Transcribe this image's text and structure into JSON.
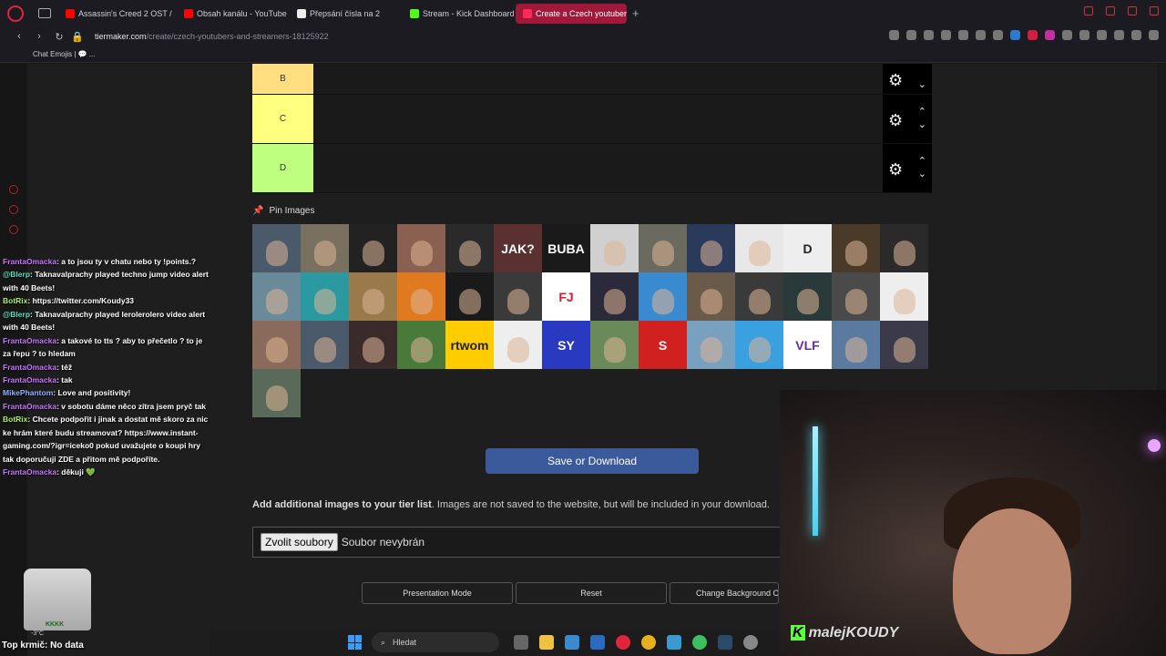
{
  "browser": {
    "tabs": [
      {
        "label": "Assassin's Creed 2 OST / ...",
        "color": "#ff0000"
      },
      {
        "label": "Obsah kanálu - YouTube S...",
        "color": "#ff0000"
      },
      {
        "label": "Přepsání čísla na 2",
        "color": "#eeeeee"
      },
      {
        "label": "Stream - Kick Dashboard",
        "color": "#53fc18"
      },
      {
        "label": "Create a Czech youtubers...",
        "color": "#ff2a5a"
      }
    ],
    "new_tab": "+",
    "url_host": "tiermaker.com",
    "url_path": "/create/czech-youtubers-and-streamers-18125922",
    "bookmark": "Chat Emojis | 💬 ..."
  },
  "tiers": [
    {
      "label": "B",
      "color": "#ffdf80"
    },
    {
      "label": "C",
      "color": "#ffff80"
    },
    {
      "label": "D",
      "color": "#bfff7f"
    }
  ],
  "pin_label": "Pin Images",
  "thumbnails": [
    {
      "bg": "#4a5a6a",
      "text": ""
    },
    {
      "bg": "#7a7060",
      "text": ""
    },
    {
      "bg": "#222222",
      "text": ""
    },
    {
      "bg": "#8a6050",
      "text": ""
    },
    {
      "bg": "#2a2a2a",
      "text": ""
    },
    {
      "bg": "#5a3030",
      "text": "JAK?"
    },
    {
      "bg": "#1a1a1a",
      "text": "BUBA"
    },
    {
      "bg": "#d0d0d0",
      "text": ""
    },
    {
      "bg": "#6a6a60",
      "text": ""
    },
    {
      "bg": "#2a3a5a",
      "text": ""
    },
    {
      "bg": "#e8e8e8",
      "text": ""
    },
    {
      "bg": "#eeeeee",
      "text": "D"
    },
    {
      "bg": "#4a3a2a",
      "text": ""
    },
    {
      "bg": "#2a2a2a",
      "text": ""
    },
    {
      "bg": "#6a8a9a",
      "text": ""
    },
    {
      "bg": "#2a9aa0",
      "text": ""
    },
    {
      "bg": "#9a7a4a",
      "text": ""
    },
    {
      "bg": "#e07a20",
      "text": ""
    },
    {
      "bg": "#1a1a1a",
      "text": ""
    },
    {
      "bg": "#3a3a3a",
      "text": ""
    },
    {
      "bg": "#ffffff",
      "text": "FJ"
    },
    {
      "bg": "#2a2a3a",
      "text": ""
    },
    {
      "bg": "#3a8ad0",
      "text": ""
    },
    {
      "bg": "#6a5a4a",
      "text": ""
    },
    {
      "bg": "#3a3a3a",
      "text": ""
    },
    {
      "bg": "#2a3a3a",
      "text": ""
    },
    {
      "bg": "#4a4a4a",
      "text": ""
    },
    {
      "bg": "#eeeeee",
      "text": ""
    },
    {
      "bg": "#8a6a5a",
      "text": ""
    },
    {
      "bg": "#4a5a6a",
      "text": ""
    },
    {
      "bg": "#3a2a2a",
      "text": ""
    },
    {
      "bg": "#4a7a3a",
      "text": ""
    },
    {
      "bg": "#ffcc00",
      "text": "rtwom"
    },
    {
      "bg": "#eeeeee",
      "text": ""
    },
    {
      "bg": "#2a3ac0",
      "text": "SY"
    },
    {
      "bg": "#6a8a5a",
      "text": ""
    },
    {
      "bg": "#d02020",
      "text": "S"
    },
    {
      "bg": "#7aa0c0",
      "text": ""
    },
    {
      "bg": "#3aa0e0",
      "text": ""
    },
    {
      "bg": "#ffffff",
      "text": "VLF"
    },
    {
      "bg": "#5a7aa0",
      "text": ""
    },
    {
      "bg": "#3a3a4a",
      "text": ""
    },
    {
      "bg": "#5a6a5a",
      "text": ""
    }
  ],
  "save_button": "Save or Download",
  "add_images": {
    "bold": "Add additional images to your tier list",
    "rest": ". Images are not saved to the website, but will be included in your download."
  },
  "file_input": {
    "button": "Zvolit soubory",
    "status": "Soubor nevybrán"
  },
  "buttons": {
    "presentation": "Presentation Mode",
    "reset": "Reset",
    "background": "Change Background C"
  },
  "chat": [
    {
      "user": "FrantaOmacka",
      "cls": "user-franta",
      "text": ": a to jsou ty v chatu nebo ty !points.?"
    },
    {
      "user": "@Blerp",
      "cls": "user-blerp",
      "text": ": Taknavalprachy played techno jump video alert with 40 Beets!"
    },
    {
      "user": "BotRix",
      "cls": "user-botrix",
      "text": ": https://twitter.com/Koudy33"
    },
    {
      "user": "@Blerp",
      "cls": "user-blerp",
      "text": ": Taknavalprachy played lerolerolero video alert with 40 Beets!"
    },
    {
      "user": "FrantaOmacka",
      "cls": "user-franta",
      "text": ": a takové to tts ? aby to přečetlo ? to je za řepu ? to hledam"
    },
    {
      "user": "FrantaOmacka",
      "cls": "user-franta",
      "text": ": též"
    },
    {
      "user": "FrantaOmacka",
      "cls": "user-franta",
      "text": ": tak"
    },
    {
      "user": "MikePhantom",
      "cls": "user-mike",
      "text": ": Love and positivity!"
    },
    {
      "user": "FrantaOmacka",
      "cls": "user-franta",
      "text": ": v sobotu dáme něco zítra jsem pryč tak"
    },
    {
      "user": "BotRix",
      "cls": "user-botrix",
      "text": ": Chcete podpořit i jinak a dostat mě skoro za nic ke hrám které budu streamovat? https://www.instant-gaming.com/?igr=iceko0 pokud uvažujete o koupi hry tak doporučuji ZDE a přitom mě podpoříte."
    },
    {
      "user": "FrantaOmacka",
      "cls": "user-franta",
      "text": ": děkuji 💚"
    }
  ],
  "overlay": {
    "top_krmic": "Top krmič: No data",
    "temp": "-3°C",
    "glass_label": "KKKK"
  },
  "cam_logo": {
    "k": "K",
    "name": "malejKOUDY"
  },
  "taskbar": {
    "search": "Hledat"
  }
}
